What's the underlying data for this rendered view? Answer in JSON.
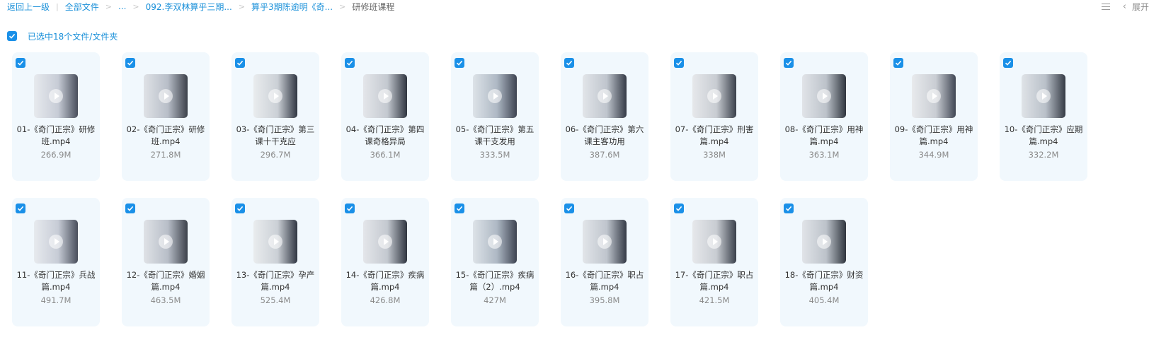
{
  "breadcrumb": {
    "back": "返回上一级",
    "root": "全部文件",
    "ellipsis": "...",
    "level1": "092.李双林算乎三期...",
    "level2": "算乎3期陈逾明《奇...",
    "current": "研修班课程"
  },
  "toolbar": {
    "chevron": "‹",
    "expand": "展开"
  },
  "selection": {
    "text": "已选中18个文件/文件夹"
  },
  "colors": {
    "accent": "#1a90e8",
    "card_bg": "#f1f8fd"
  },
  "files": [
    {
      "name": "01-《奇门正宗》研修班.mp4",
      "size": "266.9M"
    },
    {
      "name": "02-《奇门正宗》研修班.mp4",
      "size": "271.8M"
    },
    {
      "name": "03-《奇门正宗》第三课十干克应",
      "size": "296.7M"
    },
    {
      "name": "04-《奇门正宗》第四课奇格异局",
      "size": "366.1M"
    },
    {
      "name": "05-《奇门正宗》第五课干支发用",
      "size": "333.5M"
    },
    {
      "name": "06-《奇门正宗》第六课主客功用",
      "size": "387.6M"
    },
    {
      "name": "07-《奇门正宗》刑害篇.mp4",
      "size": "338M"
    },
    {
      "name": "08-《奇门正宗》用神篇.mp4",
      "size": "363.1M"
    },
    {
      "name": "09-《奇门正宗》用神篇.mp4",
      "size": "344.9M"
    },
    {
      "name": "10-《奇门正宗》应期篇.mp4",
      "size": "332.2M"
    },
    {
      "name": "11-《奇门正宗》兵战篇.mp4",
      "size": "491.7M"
    },
    {
      "name": "12-《奇门正宗》婚姻篇.mp4",
      "size": "463.5M"
    },
    {
      "name": "13-《奇门正宗》孕产篇.mp4",
      "size": "525.4M"
    },
    {
      "name": "14-《奇门正宗》疾病篇.mp4",
      "size": "426.8M"
    },
    {
      "name": "15-《奇门正宗》疾病篇（2）.mp4",
      "size": "427M"
    },
    {
      "name": "16-《奇门正宗》职占篇.mp4",
      "size": "395.8M"
    },
    {
      "name": "17-《奇门正宗》职占篇.mp4",
      "size": "421.5M"
    },
    {
      "name": "18-《奇门正宗》财资篇.mp4",
      "size": "405.4M"
    }
  ]
}
